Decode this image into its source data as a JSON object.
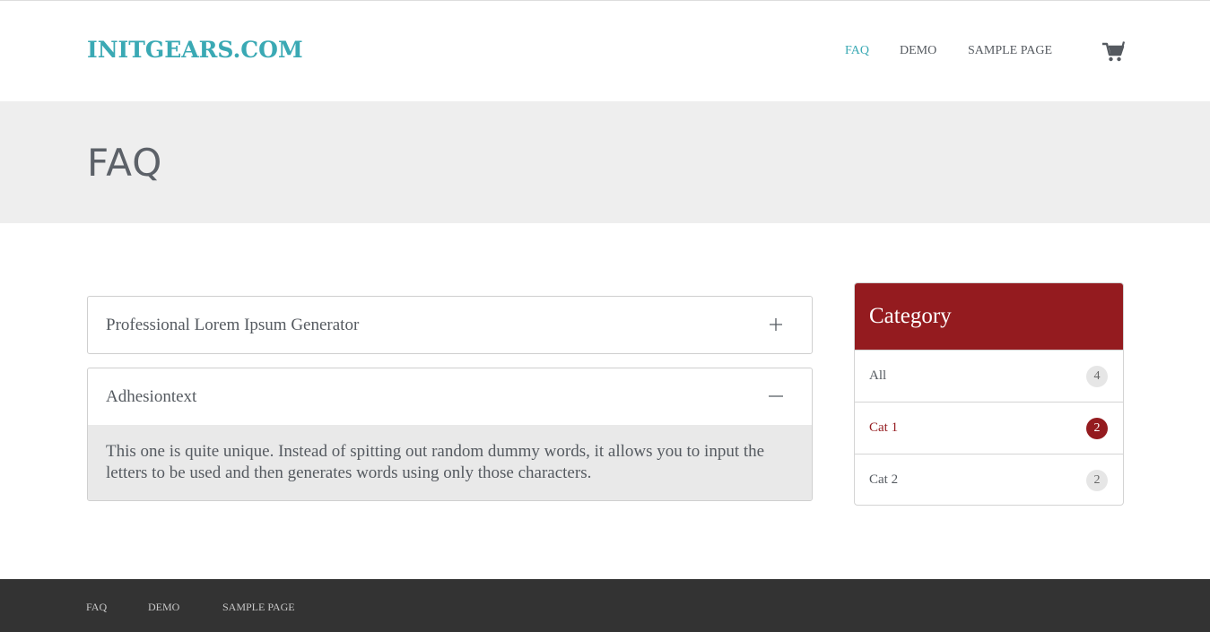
{
  "site": {
    "logo": "INITGEARS.COM"
  },
  "nav": {
    "items": [
      "FAQ",
      "DEMO",
      "SAMPLE PAGE"
    ],
    "active": "FAQ",
    "cart_icon": "shopping-cart-icon"
  },
  "banner": {
    "title": "FAQ"
  },
  "faq": [
    {
      "question": "Professional Lorem Ipsum Generator",
      "expanded": false,
      "icon": "plus-icon"
    },
    {
      "question": "Adhesiontext",
      "expanded": true,
      "icon": "minus-icon",
      "answer": "This one is quite unique. Instead of spitting out random dummy words, it allows you to input the letters to be used and then generates words using only those characters."
    }
  ],
  "category": {
    "title": "Category",
    "items": [
      {
        "label": "All",
        "count": "4",
        "active": false
      },
      {
        "label": "Cat 1",
        "count": "2",
        "active": true
      },
      {
        "label": "Cat 2",
        "count": "2",
        "active": false
      }
    ]
  },
  "footer": {
    "items": [
      "FAQ",
      "DEMO",
      "SAMPLE PAGE"
    ]
  },
  "colors": {
    "accent": "#3aa9b4",
    "brand_red": "#941b1f",
    "footer_bg": "#333333",
    "banner_bg": "#eeeeee"
  }
}
